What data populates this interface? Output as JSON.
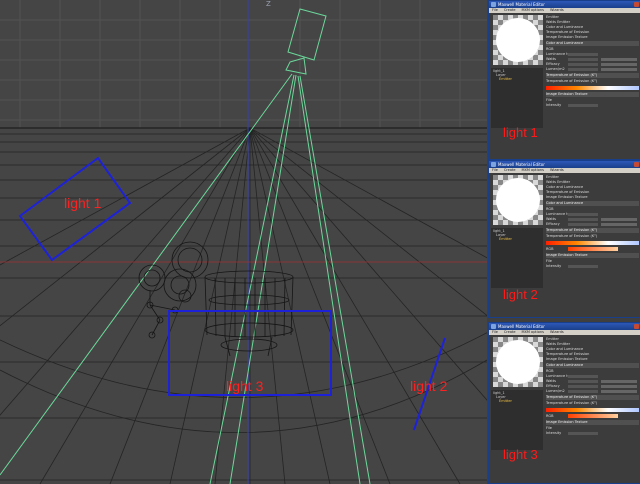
{
  "viewport": {
    "axis_label": "Z",
    "labels": {
      "top_left": "light 1",
      "bottom": "light 3",
      "right": "light 2"
    }
  },
  "panel": {
    "title": "Maxwell Material Editor",
    "menu": [
      "File",
      "Create",
      "MXM options",
      "Wizards"
    ],
    "tree": {
      "root": "light_1",
      "layer": "Layer",
      "emitter": "Emitter"
    },
    "props": {
      "header": "Emitter",
      "watts_label": "Watts",
      "watts_value": "Emitter",
      "mode_options": [
        "Color and Luminance",
        "Temperature of Emission",
        "Image Emission Texture"
      ],
      "color_section": "Color and Luminance",
      "rgb_label": "RGB",
      "fields": [
        "Luminance type",
        "Watts",
        "Efficacy",
        "Lumen/m2"
      ],
      "temp_section": "Temperature of Emission (K°)",
      "kelvin_label": "Temperature of Emission (K°)",
      "image_section": "Image Emission Texture",
      "file_label": "File",
      "intensity_label": "Intensity"
    }
  },
  "panels": [
    {
      "label": "light 1"
    },
    {
      "label": "light 2"
    },
    {
      "label": "light 3"
    }
  ]
}
